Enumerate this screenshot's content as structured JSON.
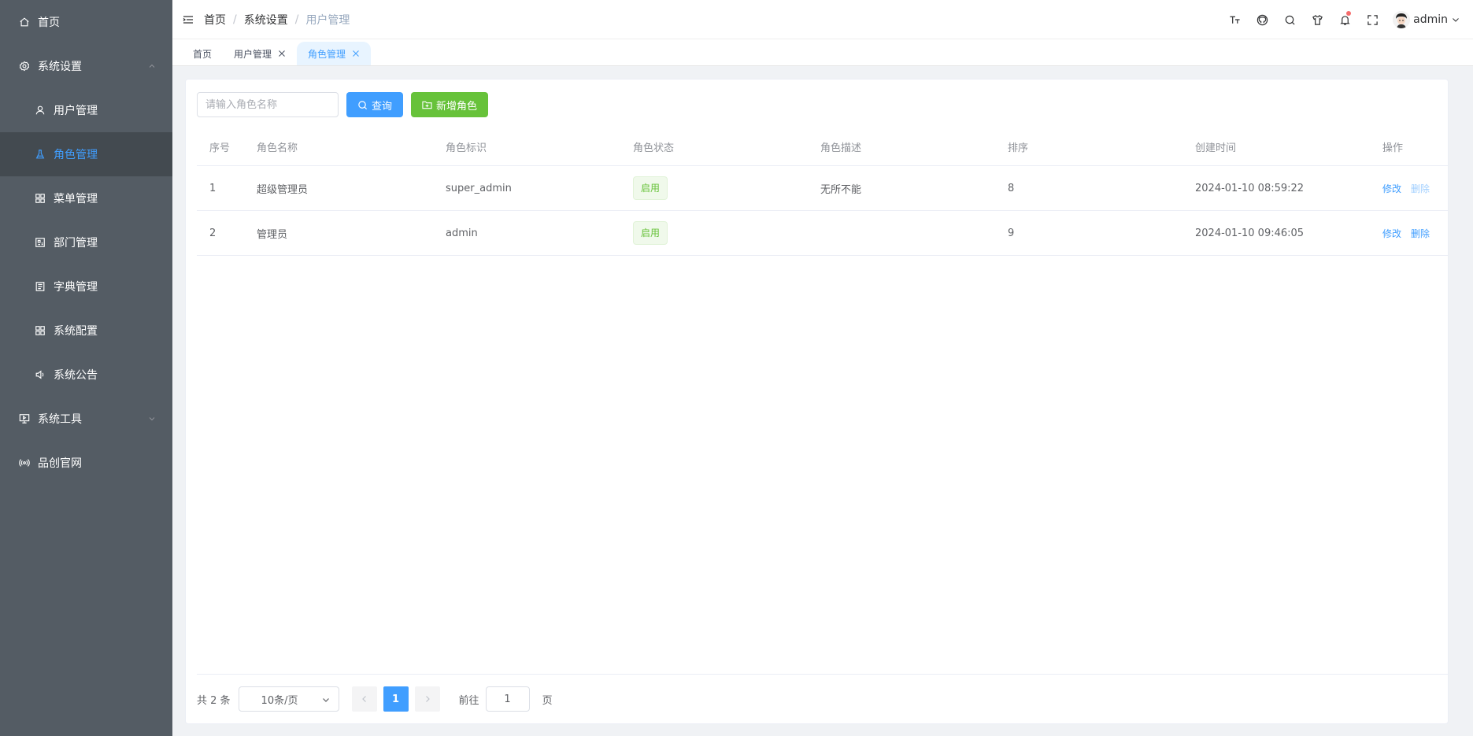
{
  "sidebar": {
    "items": [
      {
        "label": "首页",
        "icon": "home-icon"
      },
      {
        "label": "系统设置",
        "icon": "gear-icon",
        "expanded": true
      },
      {
        "label": "用户管理",
        "icon": "user-icon"
      },
      {
        "label": "角色管理",
        "icon": "flask-icon",
        "active": true
      },
      {
        "label": "菜单管理",
        "icon": "grid-icon"
      },
      {
        "label": "部门管理",
        "icon": "office-icon"
      },
      {
        "label": "字典管理",
        "icon": "notebook-icon"
      },
      {
        "label": "系统配置",
        "icon": "grid-icon"
      },
      {
        "label": "系统公告",
        "icon": "speaker-icon"
      },
      {
        "label": "系统工具",
        "icon": "monitor-icon",
        "expanded": false
      },
      {
        "label": "品创官网",
        "icon": "broadcast-icon"
      }
    ]
  },
  "header": {
    "breadcrumb": [
      "首页",
      "系统设置",
      "用户管理"
    ],
    "separator": "/",
    "user_name": "admin"
  },
  "tags": [
    {
      "label": "首页",
      "closable": false
    },
    {
      "label": "用户管理",
      "closable": true
    },
    {
      "label": "角色管理",
      "closable": true,
      "active": true
    }
  ],
  "toolbar": {
    "search_placeholder": "请输入角色名称",
    "query_label": "查询",
    "add_label": "新增角色"
  },
  "table": {
    "columns": [
      "序号",
      "角色名称",
      "角色标识",
      "角色状态",
      "角色描述",
      "排序",
      "创建时间",
      "操作"
    ],
    "rows": [
      {
        "index": "1",
        "name": "超级管理员",
        "key": "super_admin",
        "status": "启用",
        "desc": "无所不能",
        "sort": "8",
        "created": "2024-01-10 08:59:22",
        "edit": "修改",
        "delete": "删除"
      },
      {
        "index": "2",
        "name": "管理员",
        "key": "admin",
        "status": "启用",
        "desc": "",
        "sort": "9",
        "created": "2024-01-10 09:46:05",
        "edit": "修改",
        "delete": "删除"
      }
    ]
  },
  "pagination": {
    "total_text": "共 2 条",
    "page_size": "10条/页",
    "current_page": "1",
    "goto_prefix": "前往",
    "goto_value": "1",
    "goto_suffix": "页"
  },
  "colors": {
    "sidebar_bg": "#545c64",
    "active_bg": "#434a50",
    "primary": "#409eff",
    "success": "#67c23a"
  }
}
